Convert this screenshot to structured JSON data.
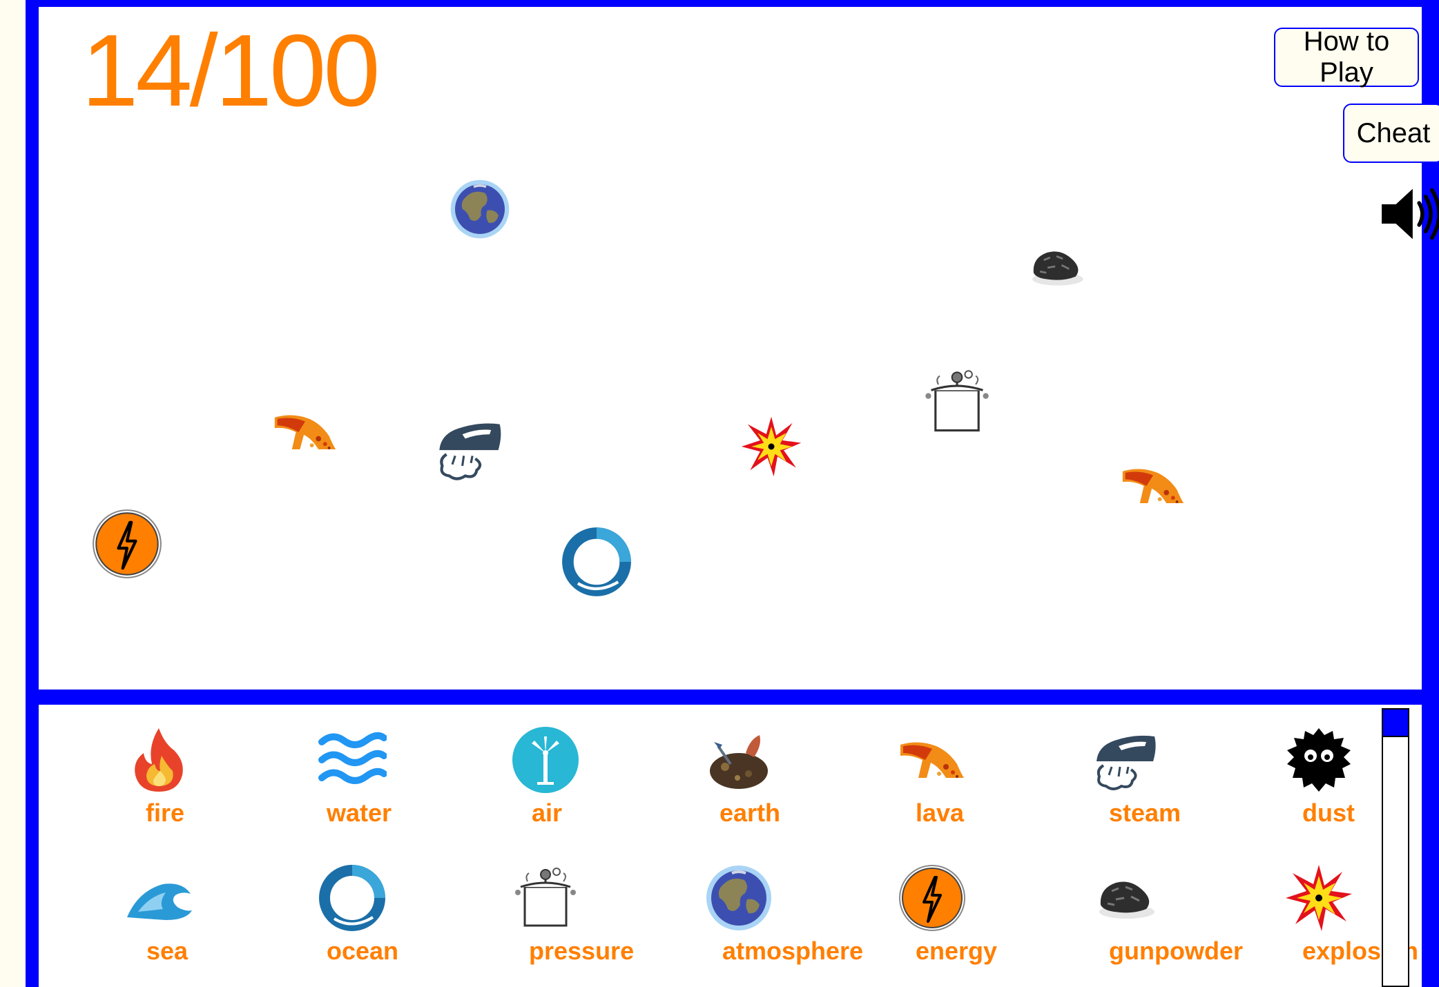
{
  "score": "14/100",
  "buttons": {
    "how_to_play": "How to Play",
    "cheat": "Cheat"
  },
  "sound": {
    "icon": "speaker-icon",
    "state": "on"
  },
  "colors": {
    "frame": "#0000ff",
    "label": "#ff7f00",
    "background": "#fffdf0"
  },
  "board_pieces": [
    {
      "element": "atmosphere",
      "icon": "planet-icon"
    },
    {
      "element": "gunpowder",
      "icon": "rock-icon"
    },
    {
      "element": "pressure",
      "icon": "pot-icon"
    },
    {
      "element": "lava",
      "icon": "lava-icon"
    },
    {
      "element": "steam",
      "icon": "iron-icon"
    },
    {
      "element": "explosion",
      "icon": "burst-icon"
    },
    {
      "element": "lava",
      "icon": "lava-icon"
    },
    {
      "element": "energy",
      "icon": "bolt-icon"
    },
    {
      "element": "ocean",
      "icon": "swirl-icon"
    }
  ],
  "discovered": [
    {
      "label": "fire",
      "icon": "flame-icon"
    },
    {
      "label": "water",
      "icon": "waves-icon"
    },
    {
      "label": "air",
      "icon": "windmill-icon"
    },
    {
      "label": "earth",
      "icon": "soil-icon"
    },
    {
      "label": "lava",
      "icon": "lava-icon"
    },
    {
      "label": "steam",
      "icon": "iron-icon"
    },
    {
      "label": "dust",
      "icon": "dust-bunny-icon"
    },
    {
      "label": "sea",
      "icon": "wave-icon"
    },
    {
      "label": "ocean",
      "icon": "swirl-icon"
    },
    {
      "label": "pressure",
      "icon": "pot-icon"
    },
    {
      "label": "atmosphere",
      "icon": "planet-icon"
    },
    {
      "label": "energy",
      "icon": "bolt-icon"
    },
    {
      "label": "gunpowder",
      "icon": "rock-icon"
    },
    {
      "label": "explosion",
      "icon": "burst-icon"
    }
  ]
}
